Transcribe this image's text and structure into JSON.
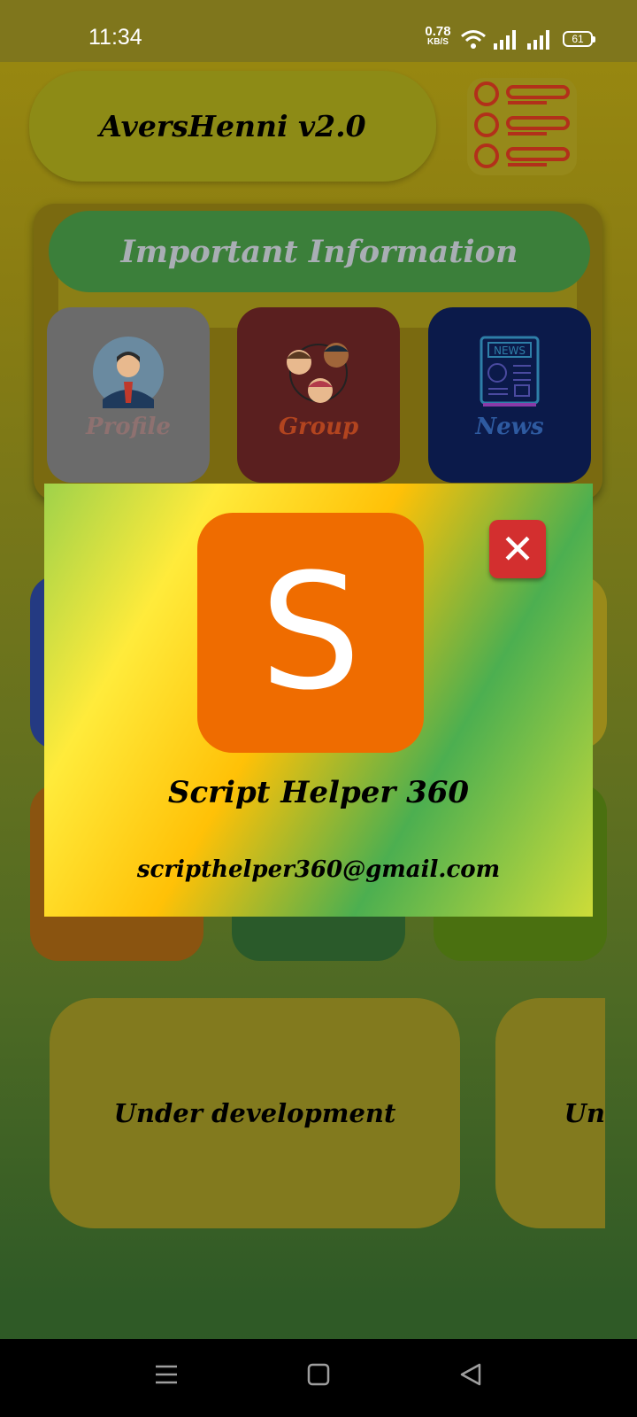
{
  "status_bar": {
    "time": "11:34",
    "net_speed": "0.78",
    "net_unit": "KB/S",
    "battery": "61"
  },
  "header": {
    "app_title": "AversHenni v2.0",
    "menu_icon": "list-menu-icon"
  },
  "info_section": {
    "title": "Important Information",
    "cards": [
      {
        "label": "Profile",
        "icon": "profile-avatar-icon",
        "color": "#6b6b6b"
      },
      {
        "label": "Group",
        "icon": "group-people-icon",
        "color": "#5a1f1f"
      },
      {
        "label": "News",
        "icon": "newspaper-icon",
        "color": "#0b1a4a"
      }
    ]
  },
  "dialog": {
    "icon_letter": "S",
    "name": "Script Helper 360",
    "email": "scripthelper360@gmail.com",
    "close_icon": "close-icon"
  },
  "dev_cards": [
    {
      "label": "Under development"
    },
    {
      "label": "Un"
    }
  ],
  "nav_bar": {
    "items": [
      "menu-icon",
      "home-icon",
      "back-icon"
    ]
  },
  "colors": {
    "accent_green": "#3b7f3a",
    "dialog_icon": "#ef6c00",
    "close_red": "#d32f2f"
  }
}
